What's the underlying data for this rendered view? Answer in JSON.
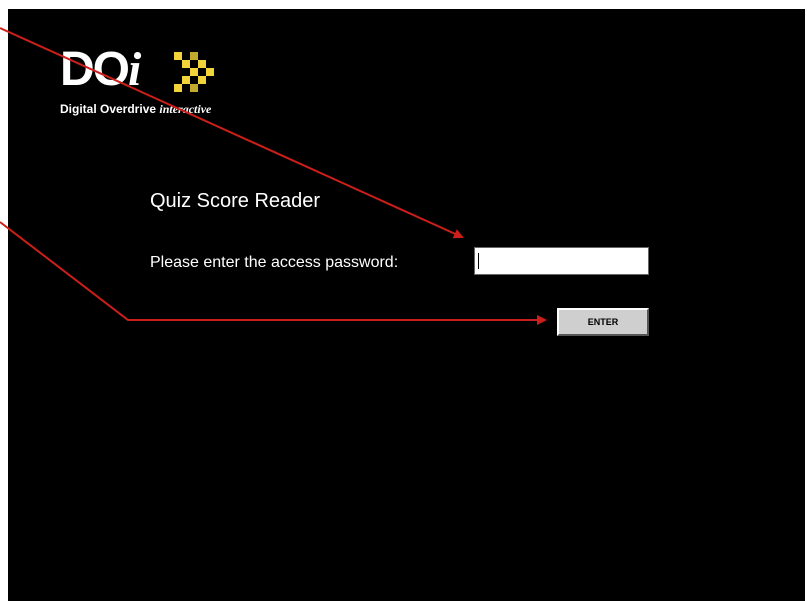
{
  "logo": {
    "doi_main": "DO",
    "doi_i": "i",
    "brand": "Digital Overdrive",
    "brand_sub": "interactive",
    "mark_color": "#f2d43a"
  },
  "page": {
    "title": "Quiz Score Reader",
    "password_prompt": "Please enter the access password:",
    "password_value": "",
    "enter_label": "ENTER"
  },
  "annotations": {
    "arrow_color": "#cc1f1a"
  }
}
